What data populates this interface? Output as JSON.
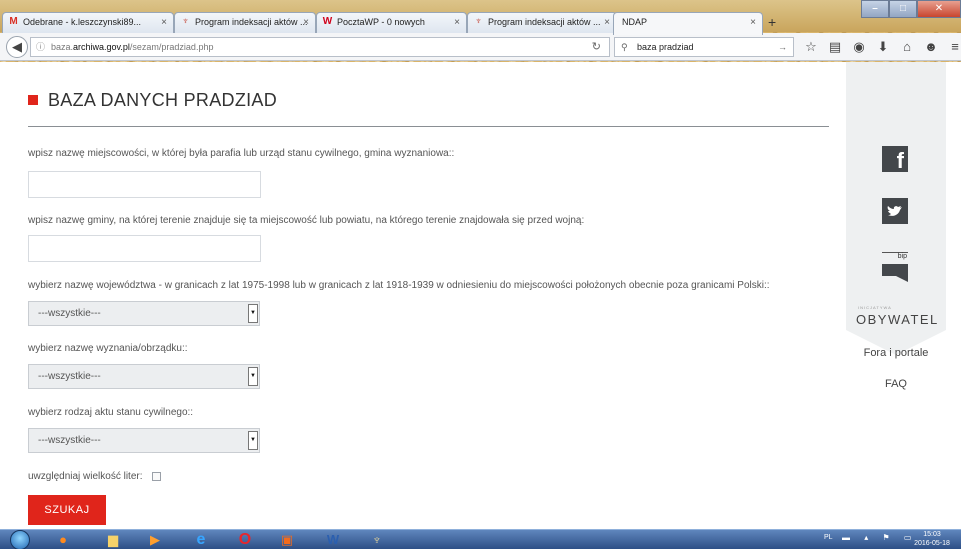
{
  "browser": {
    "tabs": [
      {
        "label": "Odebrane - k.leszczynski89...",
        "icon": "gmail-icon",
        "color": "#d93025"
      },
      {
        "label": "Program indeksacji aktów ...",
        "icon": "archive-icon",
        "color": "#c0392b"
      },
      {
        "label": "PocztaWP - 0 nowych",
        "icon": "wp-icon",
        "color": "#d0021b"
      },
      {
        "label": "Program indeksacji aktów ...",
        "icon": "archive-icon",
        "color": "#c0392b"
      },
      {
        "label": "NDAP",
        "icon": "",
        "color": ""
      }
    ],
    "active_tab_index": 4,
    "url_prefix": "baza.",
    "url_domain": "archiwa.gov.pl",
    "url_path": "/sezam/pradziad.php",
    "search_value": "baza pradziad"
  },
  "page": {
    "title": "BAZA DANYCH PRADZIAD",
    "accent_color": "#e0251b",
    "fields": {
      "miejscowosc_label": "wpisz nazwę miejscowości, w której była parafia lub urząd stanu cywilnego, gmina wyznaniowa::",
      "miejscowosc_value": "",
      "gmina_label": "wpisz nazwę gminy, na której terenie znajduje się ta miejscowość lub powiatu, na którego terenie znajdowała się przed wojną:",
      "gmina_value": "",
      "wojewodztwo_label": "wybierz nazwę województwa - w granicach z lat 1975-1998 lub w granicach z lat 1918-1939 w odniesieniu do miejscowości położonych obecnie poza granicami Polski::",
      "wojewodztwo_selected": "---wszystkie---",
      "wyznanie_label": "wybierz nazwę wyznania/obrządku::",
      "wyznanie_selected": "---wszystkie---",
      "akt_label": "wybierz rodzaj aktu stanu cywilnego::",
      "akt_selected": "---wszystkie---",
      "case_label": "uwzględniaj wielkość liter:",
      "case_checked": false
    },
    "submit_label": "SZUKAJ"
  },
  "sidebar": {
    "facebook_glyph": "f",
    "bip_text": "bip",
    "obywatel_small": "INICJATYWA",
    "obywatel": "OBYWATEL",
    "fora": "Fora i portale",
    "faq": "FAQ"
  },
  "taskbar": {
    "lang": "PL",
    "time": "15:03",
    "date": "2016-05-18"
  }
}
